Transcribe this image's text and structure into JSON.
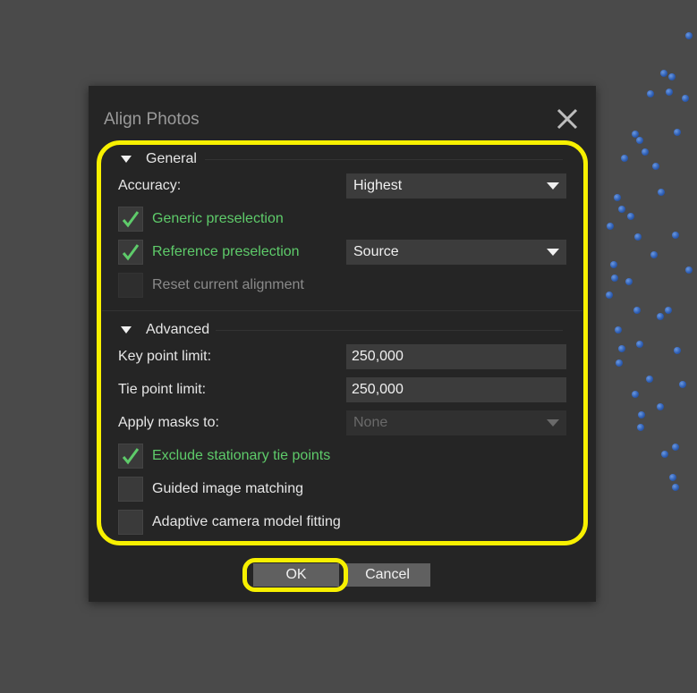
{
  "dialog": {
    "title": "Align Photos",
    "close_icon": "close-icon"
  },
  "general": {
    "header": "General",
    "accuracy_label": "Accuracy:",
    "accuracy_value": "Highest",
    "generic_preselection_label": "Generic preselection",
    "generic_preselection_checked": true,
    "reference_preselection_label": "Reference preselection",
    "reference_preselection_checked": true,
    "reference_mode_value": "Source",
    "reset_alignment_label": "Reset current alignment",
    "reset_alignment_checked": false
  },
  "advanced": {
    "header": "Advanced",
    "key_point_limit_label": "Key point limit:",
    "key_point_limit_value": "250,000",
    "tie_point_limit_label": "Tie point limit:",
    "tie_point_limit_value": "250,000",
    "apply_masks_label": "Apply masks to:",
    "apply_masks_value": "None",
    "exclude_stationary_label": "Exclude stationary tie points",
    "exclude_stationary_checked": true,
    "guided_matching_label": "Guided image matching",
    "guided_matching_checked": false,
    "adaptive_fitting_label": "Adaptive camera model fitting",
    "adaptive_fitting_checked": false
  },
  "buttons": {
    "ok": "OK",
    "cancel": "Cancel"
  },
  "colors": {
    "highlight": "#f7f000",
    "checked_text": "#5ecb6a",
    "point_cloud": "#2f5fb5"
  }
}
